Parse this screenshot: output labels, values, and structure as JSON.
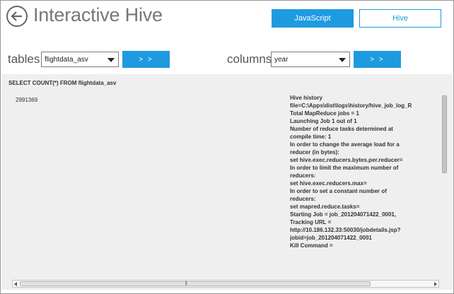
{
  "header": {
    "title": "Interactive Hive",
    "mode_buttons": {
      "javascript": "JavaScript",
      "hive": "Hive"
    }
  },
  "selectors": {
    "tables": {
      "label": "tables",
      "selected": "flightdata_asv",
      "go_label": "> >"
    },
    "columns": {
      "label": "columns",
      "selected": "year",
      "go_label": "> >"
    }
  },
  "results": {
    "query": "SELECT COUNT(*) FROM flightdata_asv",
    "value": "2991369",
    "log_lines": [
      "Hive history",
      "file=C:\\Apps\\dist\\logs\\history/hive_job_log_R",
      "Total MapReduce jobs = 1",
      "Launching Job 1 out of 1",
      "Number of reduce tasks determined at",
      "compile time: 1",
      "In order to change the average load for a",
      "reducer (in bytes):",
      "set hive.exec.reducers.bytes.per.reducer=",
      "In order to limit the maximum number of",
      "reducers:",
      "set hive.exec.reducers.max=",
      "In order to set a constant number of",
      "reducers:",
      "set mapred.reduce.tasks=",
      "Starting Job = job_201204071422_0001,",
      "Tracking URL =",
      "http://10.186.132.33:50030/jobdetails.jsp?",
      "jobid=job_201204071422_0001",
      "Kill Command ="
    ]
  },
  "colors": {
    "accent": "#1e9ae0",
    "panel_bg": "#efefef"
  },
  "icons": {
    "back": "back-arrow-icon",
    "dropdown": "chevron-down-icon"
  }
}
